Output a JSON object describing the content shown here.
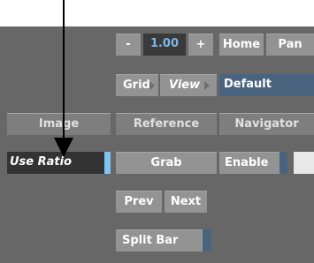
{
  "toolbar": {
    "minus": "-",
    "zoom_value": "1.00",
    "plus": "+",
    "home": "Home",
    "pan": "Pan",
    "grid": "Grid",
    "view": "View",
    "view_selection": "Default"
  },
  "side": {
    "image": "Image",
    "use_ratio": "Use Ratio"
  },
  "mid": {
    "reference": "Reference",
    "navigator": "Navigator",
    "grab": "Grab",
    "enable": "Enable",
    "prev": "Prev",
    "next": "Next",
    "split_bar": "Split Bar"
  },
  "colors": {
    "panel": "#676767",
    "button": "#939393",
    "active_blue": "#7fc3f2",
    "dropdown": "#4a6480"
  }
}
